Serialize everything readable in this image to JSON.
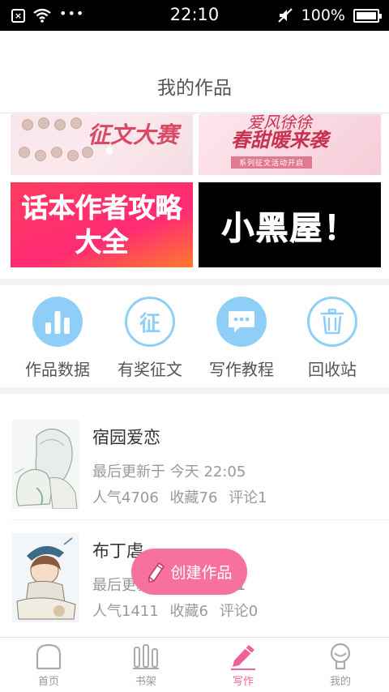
{
  "status_bar": {
    "time": "22:10",
    "dots": "•••",
    "battery_text": "100%",
    "icons": [
      "close-box-icon",
      "wifi-icon",
      "mute-icon",
      "battery-icon"
    ]
  },
  "header": {
    "title": "我的作品"
  },
  "banners": {
    "contest": {
      "title": "征文大赛"
    },
    "spring": {
      "top_line": "爱风徐徐",
      "title": "春甜暖来袭",
      "subtitle": "系列征文活动开启"
    },
    "guide": {
      "line1": "话本作者攻略",
      "line2": "大全"
    },
    "blackroom": {
      "title": "小黑屋！"
    }
  },
  "actions": [
    {
      "label": "作品数据",
      "icon": "bar-chart-icon"
    },
    {
      "label": "有奖征文",
      "icon": "contest-icon",
      "glyph": "征"
    },
    {
      "label": "写作教程",
      "icon": "chat-bubble-icon"
    },
    {
      "label": "回收站",
      "icon": "trash-icon"
    }
  ],
  "works": [
    {
      "title": "宿园爱恋",
      "updated": "最后更新于 今天 22:05",
      "popularity": "人气4706",
      "favorites": "收藏76",
      "comments": "评论1"
    },
    {
      "title": "布丁虐",
      "updated": "最后更新于 今天 22:01",
      "popularity": "人气1411",
      "favorites": "收藏6",
      "comments": "评论0"
    }
  ],
  "fab": {
    "label": "创建作品",
    "icon": "pencil-icon"
  },
  "bottom_nav": [
    {
      "label": "首页",
      "icon": "home-icon",
      "active": false
    },
    {
      "label": "书架",
      "icon": "bookshelf-icon",
      "active": false
    },
    {
      "label": "写作",
      "icon": "pen-icon",
      "active": true
    },
    {
      "label": "我的",
      "icon": "profile-icon",
      "active": false
    }
  ],
  "colors": {
    "accent_pink": "#f0609a",
    "fab_pink": "#f6729d",
    "action_blue": "#8fcff7",
    "status_bar": "#000000"
  }
}
